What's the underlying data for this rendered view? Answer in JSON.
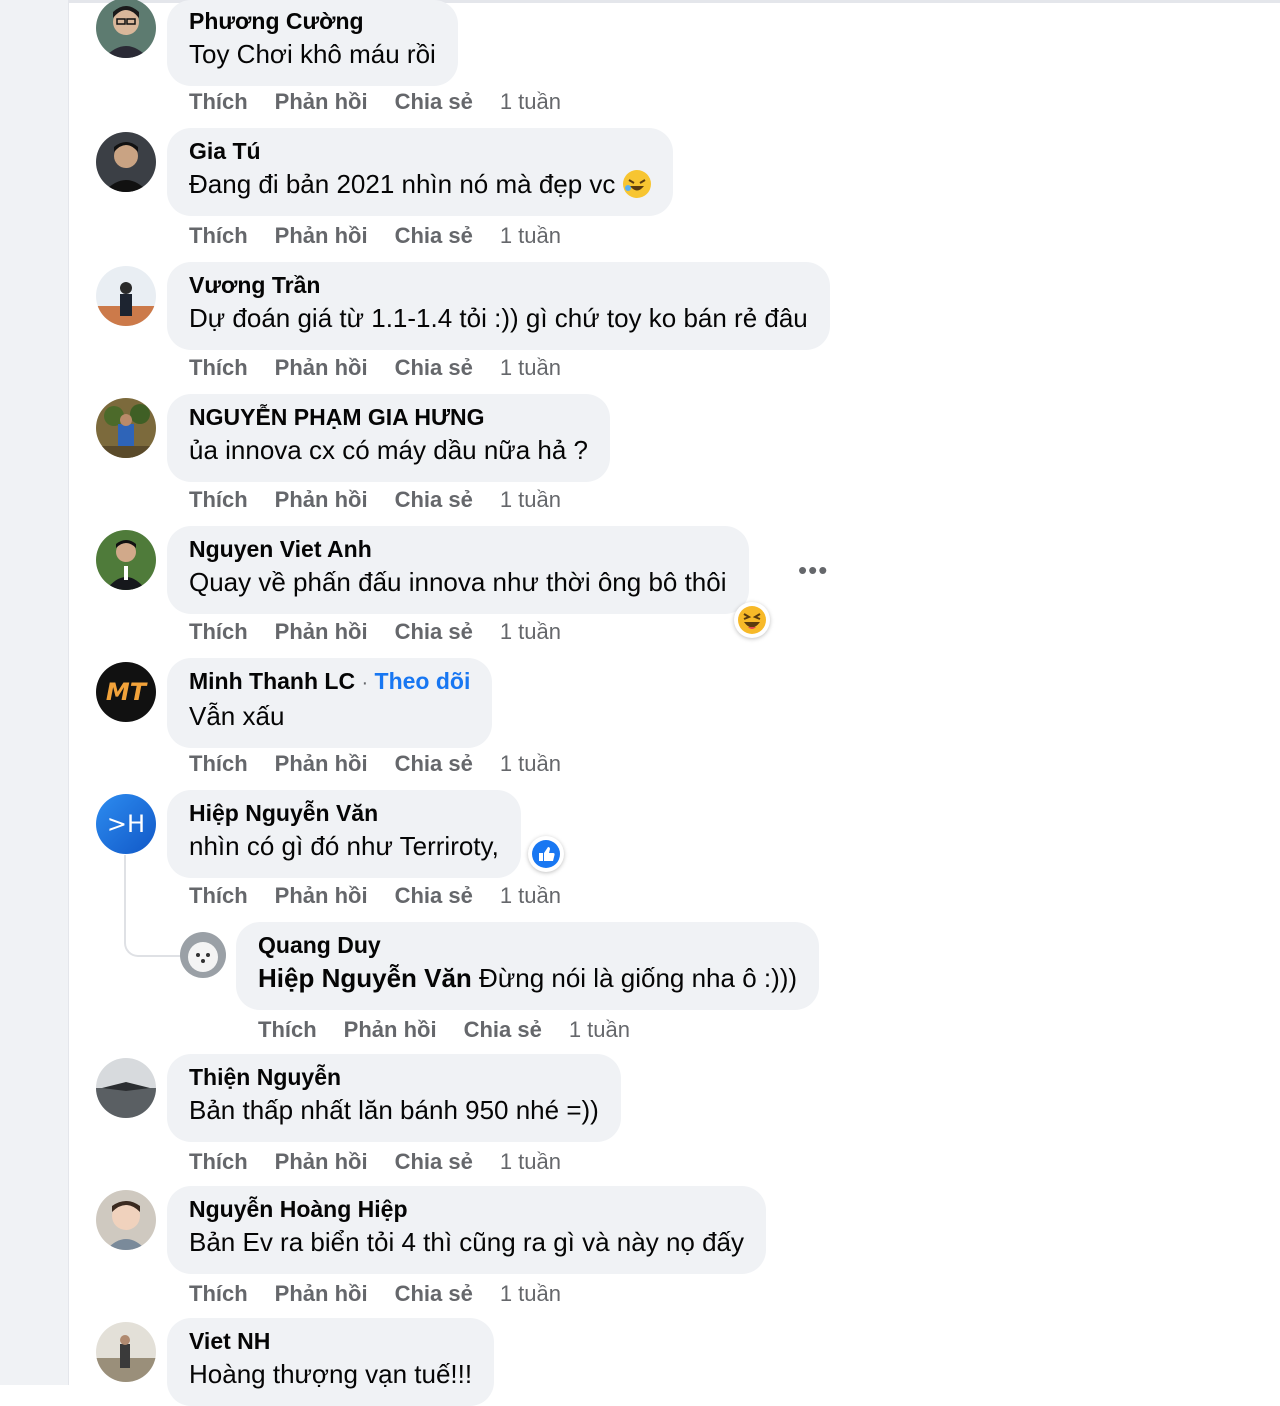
{
  "labels": {
    "like": "Thích",
    "reply": "Phản hồi",
    "share": "Chia sẻ",
    "follow": "Theo dõi"
  },
  "comments": [
    {
      "author": "Phương Cường",
      "text": "Toy Chơi khô máu rồi",
      "time": "1 tuần"
    },
    {
      "author": "Gia Tú",
      "text": "Đang đi bản 2021 nhìn nó mà đẹp vc",
      "time": "1 tuần"
    },
    {
      "author": "Vương Trần",
      "text": "Dự đoán giá từ 1.1-1.4 tỏi :)) gì chứ toy ko bán rẻ đâu",
      "time": "1 tuần"
    },
    {
      "author": "NGUYỄN PHẠM GIA HƯNG",
      "text": "ủa innova cx có máy dầu nữa hả ?",
      "time": "1 tuần"
    },
    {
      "author": "Nguyen Viet Anh",
      "text": "Quay về phấn đấu innova như thời ông bô thôi",
      "time": "1 tuần"
    },
    {
      "author": "Minh Thanh LC",
      "text": "Vẫn xấu",
      "time": "1 tuần"
    },
    {
      "author": "Hiệp Nguyễn Văn",
      "text": "nhìn có gì đó như Terriroty,",
      "time": "1 tuần"
    },
    {
      "author": "Quang Duy",
      "mention": "Hiệp Nguyễn Văn",
      "text": " Đừng nói là giống nha ô :)))",
      "time": "1 tuần"
    },
    {
      "author": "Thiện Nguyễn",
      "text": "Bản thấp nhất lăn bánh 950 nhé =))",
      "time": "1 tuần"
    },
    {
      "author": "Nguyễn Hoàng Hiệp",
      "text": "Bản Ev ra biển tỏi 4 thì cũng ra gì và này nọ đấy",
      "time": "1 tuần"
    },
    {
      "author": "Viet NH",
      "text": "Hoàng thượng vạn tuế!!!",
      "time": ""
    }
  ],
  "avatars": {
    "minh_thanh_initials": "MT",
    "hiep_initials": ">H"
  },
  "colors": {
    "accent": "#1877f2",
    "bubble": "#f0f2f5",
    "muted": "#65676b"
  }
}
